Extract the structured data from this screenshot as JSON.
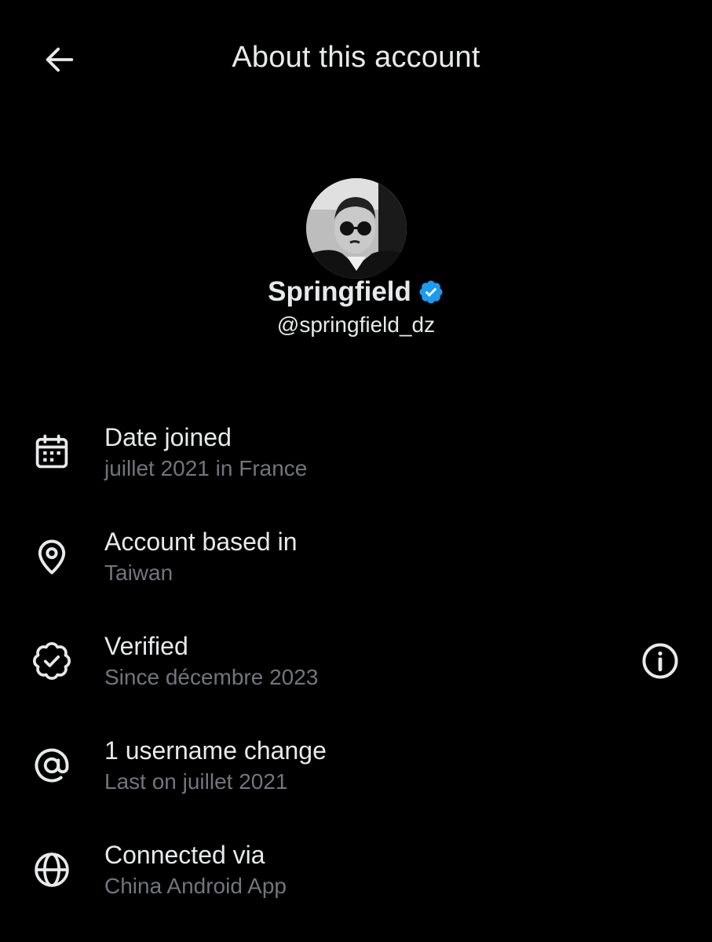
{
  "header": {
    "title": "About this account",
    "back_icon": "arrow-left-icon"
  },
  "profile": {
    "display_name": "Springfield",
    "handle": "@springfield_dz",
    "verified": true,
    "verified_color": "#1d9bf0"
  },
  "info_rows": [
    {
      "icon": "calendar-icon",
      "title": "Date joined",
      "subtitle": "juillet 2021 in France"
    },
    {
      "icon": "location-pin-icon",
      "title": "Account based in",
      "subtitle": "Taiwan"
    },
    {
      "icon": "verified-badge-outline-icon",
      "title": "Verified",
      "subtitle": "Since décembre 2023",
      "action_icon": "info-icon"
    },
    {
      "icon": "at-sign-icon",
      "title": "1 username change",
      "subtitle": "Last on juillet 2021"
    },
    {
      "icon": "globe-icon",
      "title": "Connected via",
      "subtitle": "China Android App"
    }
  ],
  "colors": {
    "background": "#000000",
    "primary_text": "#e7e9ea",
    "secondary_text": "#71767b",
    "icon": "#e7e9ea"
  }
}
